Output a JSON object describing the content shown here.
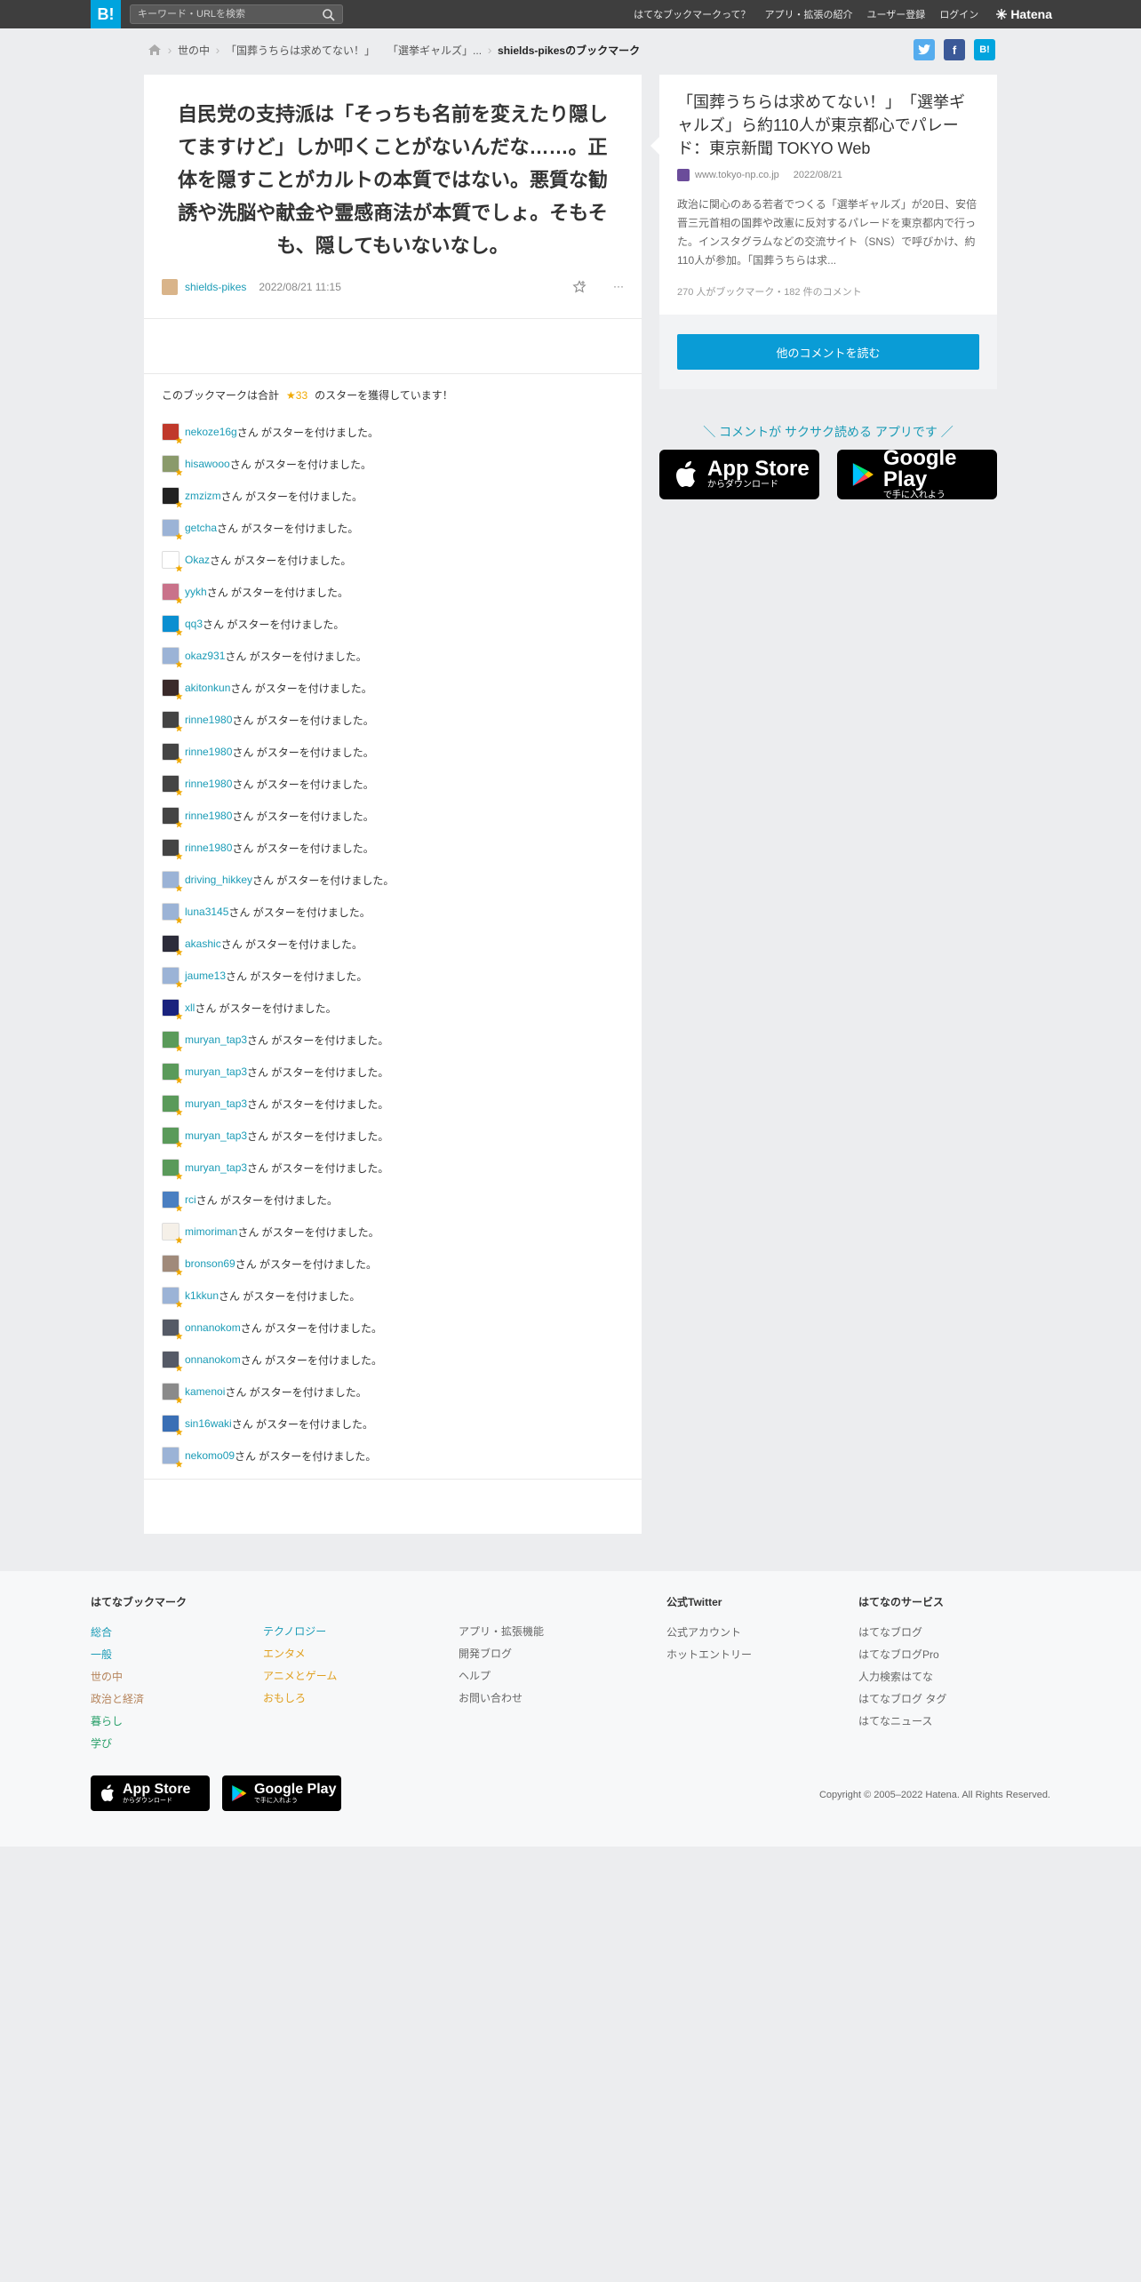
{
  "topbar": {
    "logo": "B!",
    "search_placeholder": "キーワード・URLを検索",
    "nav": [
      "はてなブックマークって？",
      "アプリ・拡張の紹介",
      "ユーザー登録",
      "ログイン"
    ],
    "brand": "Hatena"
  },
  "breadcrumb": {
    "items": [
      "世の中",
      "「国葬うちらは求めてない！」",
      "「選挙ギャルズ」..."
    ],
    "current": "shields-pikesのブックマーク"
  },
  "share": {
    "twitter": "t",
    "facebook": "f",
    "hatena": "B!"
  },
  "bookmark": {
    "comment": "自民党の支持派は「そっちも名前を変えたり隠してますけど」しか叩くことがないんだな……。正体を隠すことがカルトの本質ではない。悪質な勧誘や洗脳や献金や霊感商法が本質でしょ。そもそも、隠してもいないなし。",
    "user": "shields-pikes",
    "date": "2022/08/21 11:15",
    "more": "···"
  },
  "stars": {
    "summary_prefix": "このブックマークは合計",
    "count": "★33",
    "summary_suffix": "のスターを獲得しています！",
    "suffix": "さん がスターを付けました。",
    "list": [
      {
        "name": "nekoze16g",
        "color": "#c0392b"
      },
      {
        "name": "hisawooo",
        "color": "#8a9a6b"
      },
      {
        "name": "zmzizm",
        "color": "#222222"
      },
      {
        "name": "getcha",
        "color": "#9bb3d6"
      },
      {
        "name": "Okaz",
        "color": "#ffffff"
      },
      {
        "name": "yykh",
        "color": "#c9728a"
      },
      {
        "name": "qq3",
        "color": "#0a8fd1"
      },
      {
        "name": "okaz931",
        "color": "#9bb3d6"
      },
      {
        "name": "akitonkun",
        "color": "#3a2a2a"
      },
      {
        "name": "rinne1980",
        "color": "#444444"
      },
      {
        "name": "rinne1980",
        "color": "#444444"
      },
      {
        "name": "rinne1980",
        "color": "#444444"
      },
      {
        "name": "rinne1980",
        "color": "#444444"
      },
      {
        "name": "rinne1980",
        "color": "#444444"
      },
      {
        "name": "driving_hikkey",
        "color": "#9bb3d6"
      },
      {
        "name": "luna3145",
        "color": "#9bb3d6"
      },
      {
        "name": "akashic",
        "color": "#2c2c3a"
      },
      {
        "name": "jaume13",
        "color": "#9bb3d6"
      },
      {
        "name": "xll",
        "color": "#1a237e"
      },
      {
        "name": "muryan_tap3",
        "color": "#5a9a5a"
      },
      {
        "name": "muryan_tap3",
        "color": "#5a9a5a"
      },
      {
        "name": "muryan_tap3",
        "color": "#5a9a5a"
      },
      {
        "name": "muryan_tap3",
        "color": "#5a9a5a"
      },
      {
        "name": "muryan_tap3",
        "color": "#5a9a5a"
      },
      {
        "name": "rci",
        "color": "#4a7fc1"
      },
      {
        "name": "mimoriman",
        "color": "#f5f0e8"
      },
      {
        "name": "bronson69",
        "color": "#a08a7a"
      },
      {
        "name": "k1kkun",
        "color": "#9bb3d6"
      },
      {
        "name": "onnanokom",
        "color": "#555a66"
      },
      {
        "name": "onnanokom",
        "color": "#555a66"
      },
      {
        "name": "kamenoi",
        "color": "#8a8a8a"
      },
      {
        "name": "sin16waki",
        "color": "#3a6fb5"
      },
      {
        "name": "nekomo09",
        "color": "#9bb3d6"
      }
    ]
  },
  "entry": {
    "title": "「国葬うちらは求めてない！」　「選挙ギャルズ」ら約110人が東京都心でパレード：東京新聞 TOKYO Web",
    "site": "www.tokyo-np.co.jp",
    "date": "2022/08/21",
    "description": "政治に関心のある若者でつくる「選挙ギャルズ」が20日、安倍晋三元首相の国葬や改憲に反対するパレードを東京都内で行った。インスタグラムなどの交流サイト（SNS）で呼びかけ、約110人が参加。「国葬うちらは求...",
    "stats": "270 人がブックマーク・182 件のコメント",
    "more_button": "他のコメントを読む"
  },
  "promo": {
    "text": "＼ コメントが サクサク読める アプリです ／",
    "appstore_big": "App Store",
    "appstore_small": "からダウンロード",
    "googleplay_big": "Google Play",
    "googleplay_small": "で手に入れよう"
  },
  "footer": {
    "col1_head": "はてなブックマーク",
    "col1": [
      {
        "label": "総合",
        "color": "#1a9bb6"
      },
      {
        "label": "一般",
        "color": "#1a9bb6"
      },
      {
        "label": "世の中",
        "color": "#b5835a"
      },
      {
        "label": "政治と経済",
        "color": "#b5835a"
      },
      {
        "label": "暮らし",
        "color": "#2aa06a"
      },
      {
        "label": "学び",
        "color": "#2aa06a"
      }
    ],
    "col2": [
      {
        "label": "テクノロジー",
        "color": "#1a9bb6"
      },
      {
        "label": "エンタメ",
        "color": "#e0a020"
      },
      {
        "label": "アニメとゲーム",
        "color": "#e0a020"
      },
      {
        "label": "おもしろ",
        "color": "#e0a020"
      }
    ],
    "col3": [
      "アプリ・拡張機能",
      "開発ブログ",
      "ヘルプ",
      "お問い合わせ"
    ],
    "col4_head": "公式Twitter",
    "col4": [
      "公式アカウント",
      "ホットエントリー"
    ],
    "col5_head": "はてなのサービス",
    "col5": [
      "はてなブログ",
      "はてなブログPro",
      "人力検索はてな",
      "はてなブログ タグ",
      "はてなニュース"
    ],
    "copyright": "Copyright © 2005–2022 Hatena. All Rights Reserved."
  }
}
